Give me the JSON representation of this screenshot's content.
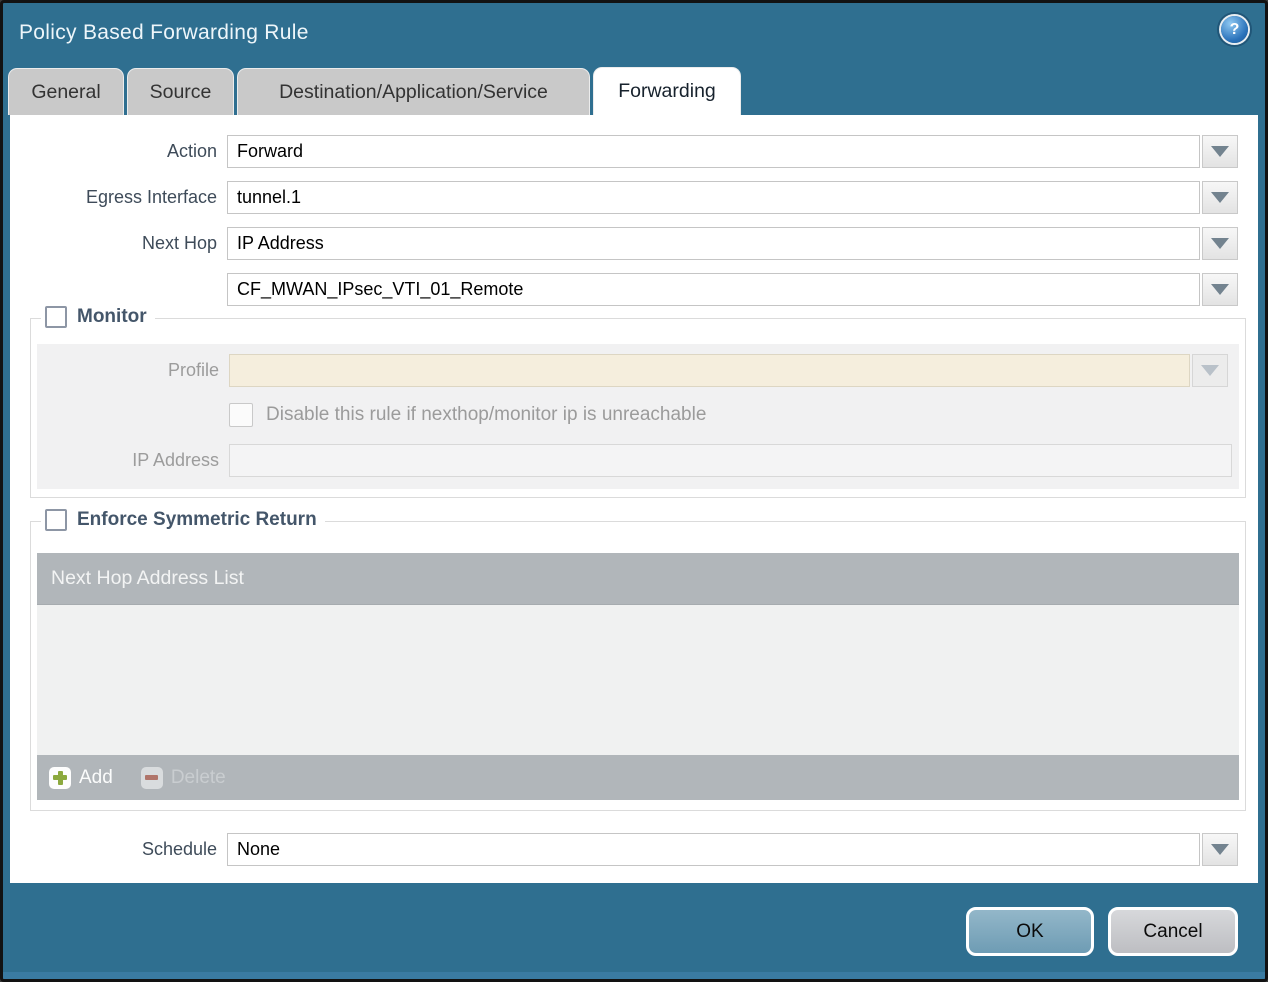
{
  "window": {
    "title": "Policy Based Forwarding Rule"
  },
  "icons": {
    "help_glyph": "?"
  },
  "tabs": [
    {
      "label": "General",
      "active": false
    },
    {
      "label": "Source",
      "active": false
    },
    {
      "label": "Destination/Application/Service",
      "active": false
    },
    {
      "label": "Forwarding",
      "active": true
    }
  ],
  "form": {
    "action": {
      "label": "Action",
      "value": "Forward"
    },
    "egress_interface": {
      "label": "Egress Interface",
      "value": "tunnel.1"
    },
    "next_hop": {
      "label": "Next Hop",
      "value": "IP Address"
    },
    "next_hop_address": {
      "value": "CF_MWAN_IPsec_VTI_01_Remote"
    },
    "schedule": {
      "label": "Schedule",
      "value": "None"
    }
  },
  "monitor": {
    "legend": "Monitor",
    "checked": false,
    "profile": {
      "label": "Profile",
      "value": ""
    },
    "disable_rule": {
      "label": "Disable this rule if nexthop/monitor ip is unreachable",
      "checked": false
    },
    "ip_address": {
      "label": "IP Address",
      "value": ""
    }
  },
  "symmetric_return": {
    "legend": "Enforce Symmetric Return",
    "checked": false,
    "table": {
      "header": "Next Hop Address List",
      "rows": [],
      "add_label": "Add",
      "delete_label": "Delete"
    }
  },
  "footer": {
    "ok_label": "OK",
    "cancel_label": "Cancel"
  },
  "colors": {
    "chrome_teal": "#2f6f90",
    "ok_button": "#7ea9bf",
    "disabled_field_beige": "#f5eedd",
    "table_gray": "#b1b6ba"
  }
}
